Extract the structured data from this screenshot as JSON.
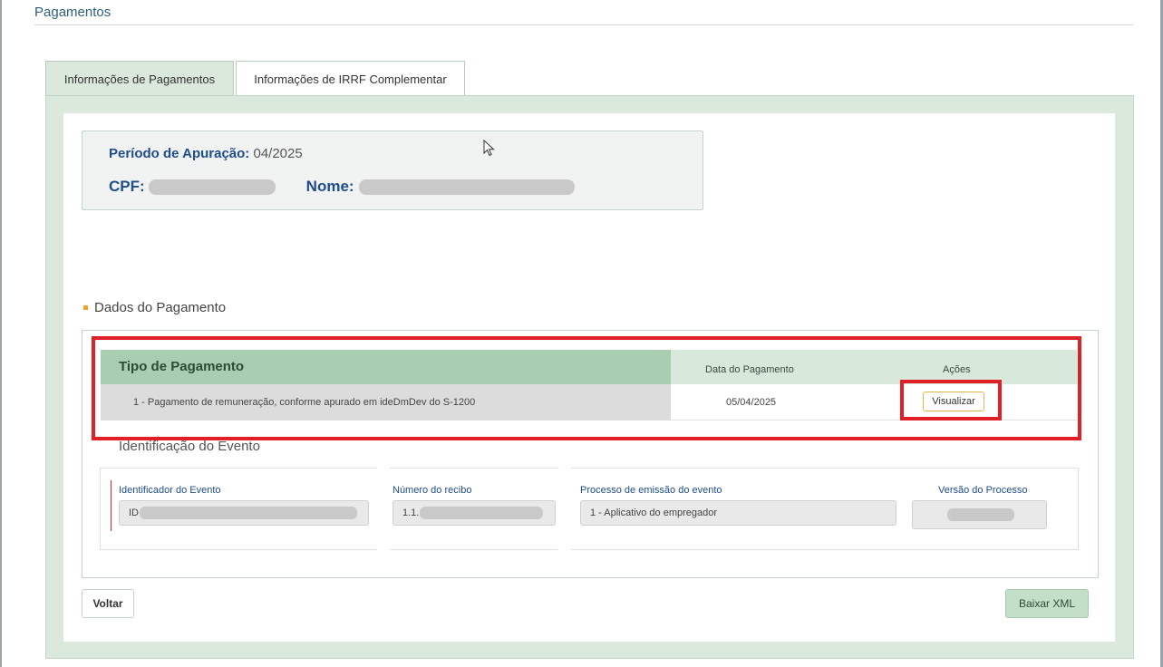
{
  "page": {
    "title": "Pagamentos"
  },
  "tabs": [
    {
      "label": "Informações de Pagamentos",
      "active": true
    },
    {
      "label": "Informações de IRRF Complementar",
      "active": false
    }
  ],
  "info": {
    "periodo_label": "Período de Apuração:",
    "periodo_value": "04/2025",
    "cpf_label": "CPF:",
    "nome_label": "Nome:"
  },
  "dados": {
    "section_title": "Dados do Pagamento",
    "columns": {
      "tipo": "Tipo de Pagamento",
      "data": "Data do Pagamento",
      "acoes": "Ações"
    },
    "rows": [
      {
        "tipo": "1 - Pagamento de remuneração, conforme apurado em ideDmDev do S-1200",
        "data": "05/04/2025",
        "action_label": "Visualizar"
      }
    ]
  },
  "identificacao": {
    "title": "Identificação do Evento",
    "fields": {
      "identificador": {
        "label": "Identificador do Evento",
        "value_prefix": "ID"
      },
      "recibo": {
        "label": "Número do recibo",
        "value_prefix": "1.1."
      },
      "processo": {
        "label": "Processo de emissão do evento",
        "value": "1 - Aplicativo do empregador"
      },
      "versao": {
        "label": "Versão do Processo"
      }
    }
  },
  "actions": {
    "voltar": "Voltar",
    "baixar_xml": "Baixar XML"
  },
  "colors": {
    "highlight": "#e01f26",
    "header_green": "#a8ceb1",
    "panel_green": "#dbe8dc",
    "label_blue": "#1f4d8a",
    "bullet": "#f0a030"
  },
  "icons": {
    "cursor": "mouse-pointer-icon",
    "bullet": "square-bullet-icon"
  }
}
